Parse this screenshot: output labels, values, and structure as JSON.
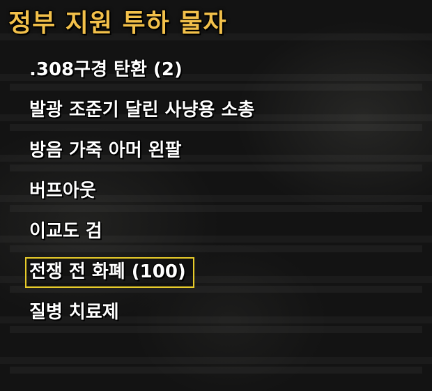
{
  "panel": {
    "title": "정부 지원 투하 물자"
  },
  "items": [
    {
      "label": ".308구경 탄환 (2)",
      "selected": false
    },
    {
      "label": "발광 조준기 달린 사냥용 소총",
      "selected": false
    },
    {
      "label": "방음 가죽 아머 왼팔",
      "selected": false
    },
    {
      "label": "버프아웃",
      "selected": false
    },
    {
      "label": "이교도 검",
      "selected": false
    },
    {
      "label": "전쟁 전 화폐 (100)",
      "selected": true
    },
    {
      "label": "질병 치료제",
      "selected": false
    }
  ],
  "colors": {
    "title": "#f2c04a",
    "item_text": "#ffffff",
    "selection_border": "#e8cc2a",
    "background": "#131313"
  }
}
